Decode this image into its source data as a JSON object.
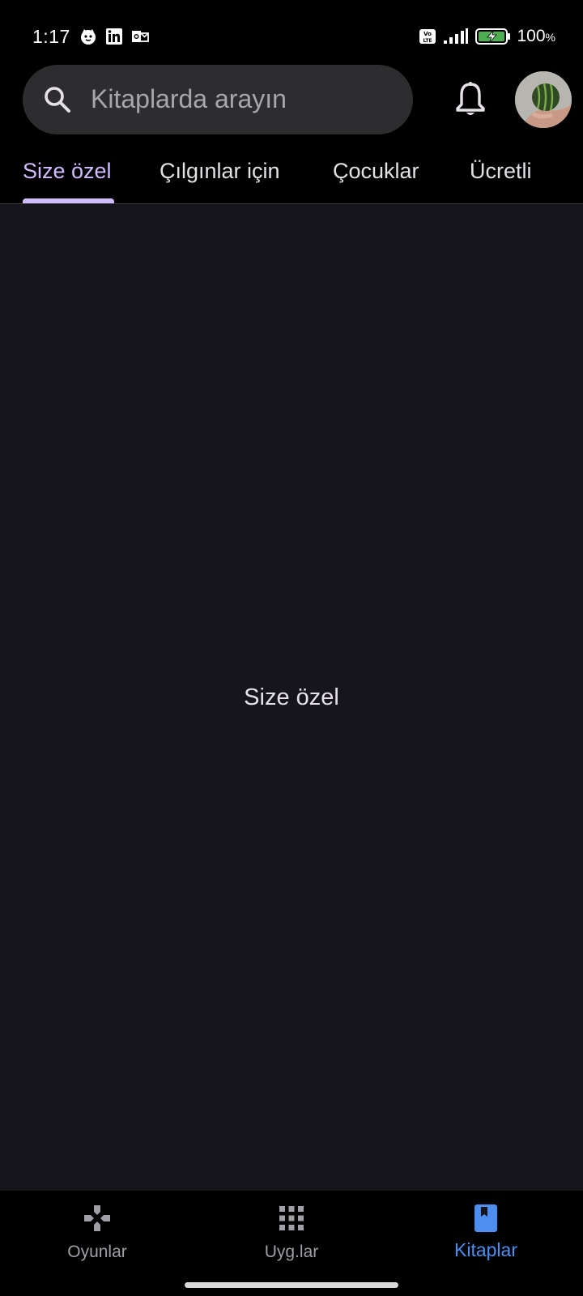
{
  "status_bar": {
    "time": "1:17",
    "battery_percent": "100",
    "battery_unit": "%"
  },
  "search": {
    "placeholder": "Kitaplarda arayın"
  },
  "tabs": [
    {
      "label": "Size özel",
      "active": true
    },
    {
      "label": "Çılgınlar için",
      "active": false
    },
    {
      "label": "Çocuklar",
      "active": false
    },
    {
      "label": "Ücretli",
      "active": false
    }
  ],
  "main": {
    "content_label": "Size özel"
  },
  "bottom_nav": [
    {
      "label": "Oyunlar",
      "icon": "gamepad-icon",
      "active": false
    },
    {
      "label": "Uyg.lar",
      "icon": "apps-grid-icon",
      "active": false
    },
    {
      "label": "Kitaplar",
      "icon": "book-icon",
      "active": true
    }
  ],
  "colors": {
    "accent_tab": "#d1bcff",
    "accent_nav": "#4e8ef0",
    "background": "#17151c"
  }
}
